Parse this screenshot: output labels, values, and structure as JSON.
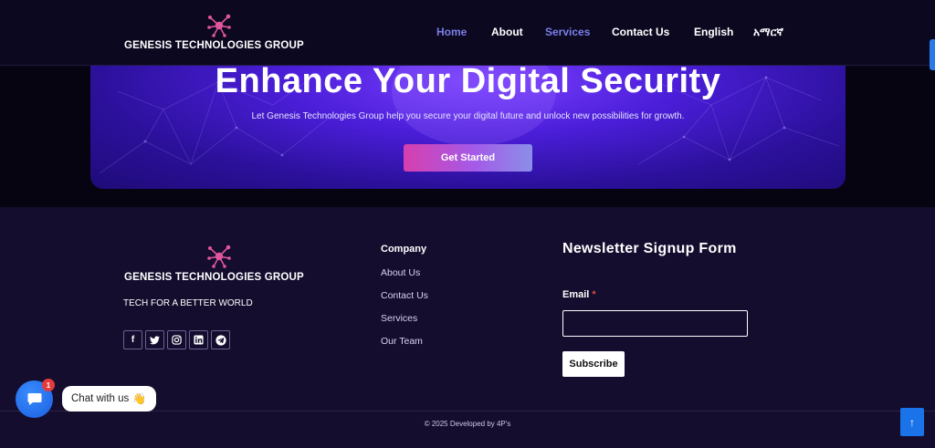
{
  "header": {
    "brand_name": "GENESIS TECHNOLOGIES GROUP",
    "nav": [
      {
        "label": "Home",
        "active": true
      },
      {
        "label": "About",
        "active": false
      },
      {
        "label": "Services",
        "active": true
      },
      {
        "label": "Contact Us",
        "active": false
      },
      {
        "label": "English",
        "active": false
      },
      {
        "label": "አማርኛ",
        "active": false
      }
    ]
  },
  "hero": {
    "title": "Enhance Your Digital Security",
    "subtitle": "Let Genesis Technologies Group help you secure your digital future and unlock new possibilities for growth.",
    "cta_label": "Get Started"
  },
  "footer": {
    "brand_name": "GENESIS TECHNOLOGIES GROUP",
    "tagline": "TECH FOR A BETTER WORLD",
    "socials": [
      {
        "icon": "facebook-icon",
        "glyph": "f"
      },
      {
        "icon": "twitter-icon",
        "glyph": "🐦"
      },
      {
        "icon": "instagram-icon",
        "glyph": "◎"
      },
      {
        "icon": "linkedin-icon",
        "glyph": "in"
      },
      {
        "icon": "telegram-icon",
        "glyph": "➤"
      }
    ],
    "company": {
      "title": "Company",
      "links": [
        "About Us",
        "Contact Us",
        "Services",
        "Our Team"
      ]
    },
    "newsletter": {
      "title": "Newsletter Signup Form",
      "email_label": "Email",
      "required_mark": "*",
      "email_value": "",
      "subscribe_label": "Subscribe"
    },
    "copyright": "© 2025 Developed by 4P's"
  },
  "chat": {
    "badge_count": "1",
    "label": "Chat with us",
    "emoji": "👋"
  },
  "scroll_top_glyph": "↑",
  "colors": {
    "accent_nav": "#7b7ee8",
    "chat_blue": "#1a5fe0",
    "cta_gradient_start": "#d63fae",
    "cta_gradient_end": "#8a8fe8"
  }
}
